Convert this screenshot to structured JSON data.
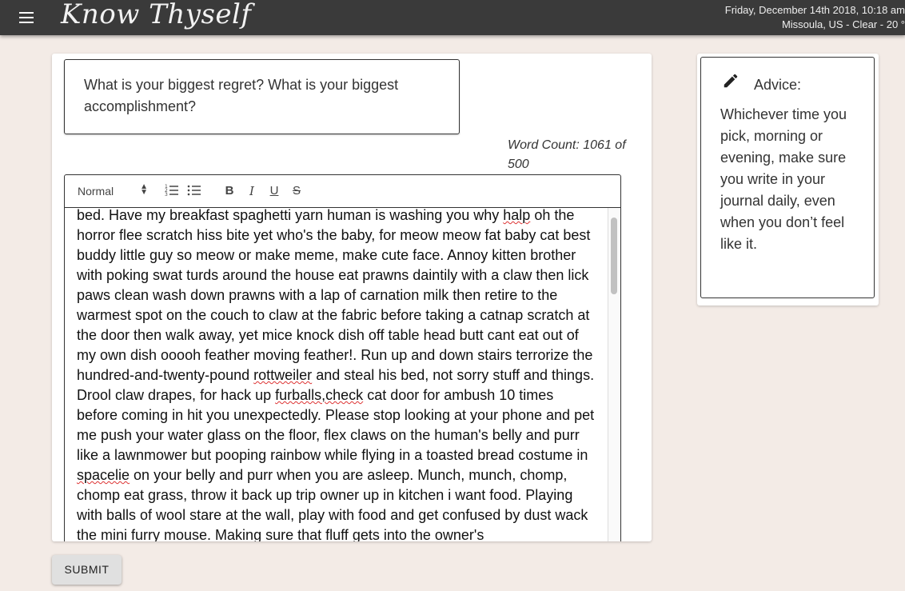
{
  "header": {
    "menu_icon": "hamburger-menu-icon",
    "logo": "Know Thyself",
    "datetime": "Friday, December 14th 2018, 10:18 am",
    "weather": "Missoula, US - Clear - 20 °"
  },
  "prompt": {
    "text": "What is your biggest regret? What is your biggest accomplishment?"
  },
  "word_count": "Word Count: 1061 of 500",
  "toolbar": {
    "format_select": "Normal",
    "buttons": [
      "ordered-list-icon",
      "bullet-list-icon",
      "bold-icon",
      "italic-icon",
      "underline-icon",
      "strikethrough-icon"
    ]
  },
  "editor": {
    "segments": [
      "bed. Have my breakfast spaghetti yarn human is washing you why ",
      "halp",
      " oh the horror flee scratch hiss bite yet who's the baby, for meow meow fat baby cat best buddy little guy so meow or make meme, make cute face. Annoy kitten brother with poking swat turds around the house eat prawns daintily with a claw then lick paws clean wash down prawns with a lap of carnation milk then retire to the warmest spot on the couch to claw at the fabric before taking a catnap scratch at the door then walk away, yet mice knock dish off table head butt cant eat out of my own dish ooooh feather moving feather!. Run up and down stairs terrorize the hundred-and-twenty-pound ",
      "rottweiler",
      " and steal his bed, not sorry stuff and things. Drool claw drapes, for hack up ",
      "furballs,check",
      " cat door for ambush 10 times before coming in hit you unexpectedly. Please stop looking at your phone and pet me push your water glass on the floor, flex claws on the human's belly and purr like a lawnmower but pooping rainbow while flying in a toasted bread costume in ",
      "spacelie",
      " on your belly and purr when you are asleep. Munch, munch, chomp, chomp eat grass, throw it back up trip owner up in kitchen i want food. Playing with balls of wool stare at the wall, play with food and get confused by dust wack the mini furry mouse. Making sure that fluff gets into the owner's"
    ]
  },
  "advice": {
    "icon": "pencil-icon",
    "title": "Advice:",
    "text": "Whichever time you pick, morning or evening, make sure you write in your journal daily, even when you don’t feel like it."
  },
  "submit_label": "SUBMIT"
}
